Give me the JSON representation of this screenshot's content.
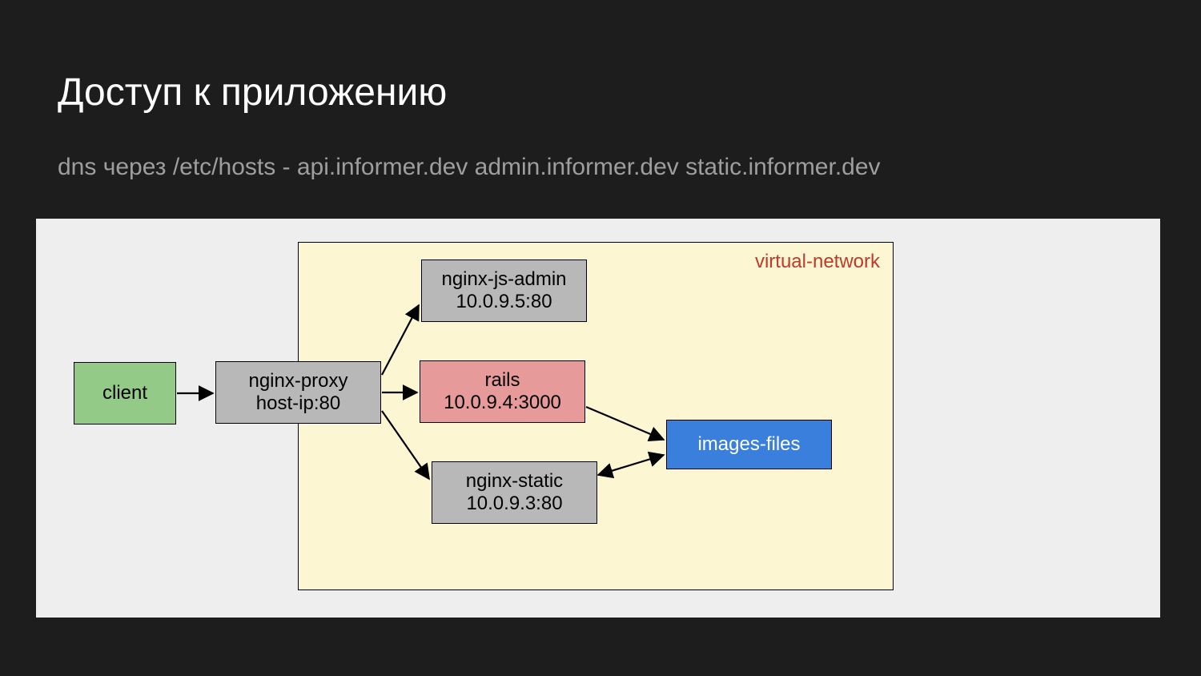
{
  "title": "Доступ к приложению",
  "subtitle": "dns через /etc/hosts - api.informer.dev admin.informer.dev static.informer.dev",
  "diagram": {
    "network_label": "virtual-network",
    "client": "client",
    "proxy": {
      "name": "nginx-proxy",
      "addr": "host-ip:80"
    },
    "admin": {
      "name": "nginx-js-admin",
      "addr": "10.0.9.5:80"
    },
    "rails": {
      "name": "rails",
      "addr": "10.0.9.4:3000"
    },
    "static": {
      "name": "nginx-static",
      "addr": "10.0.9.3:80"
    },
    "images": "images-files"
  }
}
